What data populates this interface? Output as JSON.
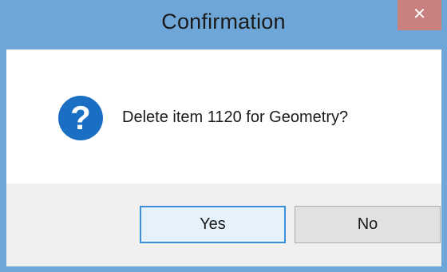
{
  "window": {
    "title": "Confirmation",
    "close_glyph": "✕"
  },
  "dialog": {
    "icon": "question-icon",
    "icon_glyph": "?",
    "message": "Delete item 1120 for Geometry?"
  },
  "buttons": {
    "yes_label": "Yes",
    "no_label": "No"
  },
  "colors": {
    "titlebar": "#6ea6d8",
    "close_button": "#c9807e",
    "icon": "#1a6fc4",
    "default_button_border": "#3c8fd6"
  }
}
